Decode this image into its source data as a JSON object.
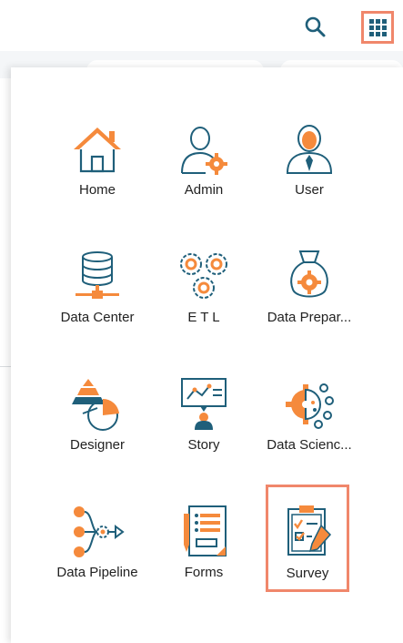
{
  "header": {
    "search_icon": "search-icon",
    "apps_icon": "apps-grid-icon"
  },
  "apps": [
    {
      "label": "Home",
      "icon": "home-icon"
    },
    {
      "label": "Admin",
      "icon": "admin-icon"
    },
    {
      "label": "User",
      "icon": "user-icon"
    },
    {
      "label": "Data Center",
      "icon": "data-center-icon"
    },
    {
      "label": "E T L",
      "icon": "etl-gears-icon"
    },
    {
      "label": "Data Prepar...",
      "icon": "data-preparation-icon"
    },
    {
      "label": "Designer",
      "icon": "designer-chart-icon"
    },
    {
      "label": "Story",
      "icon": "story-presentation-icon"
    },
    {
      "label": "Data Scienc...",
      "icon": "data-science-icon"
    },
    {
      "label": "Data Pipeline",
      "icon": "data-pipeline-icon"
    },
    {
      "label": "Forms",
      "icon": "forms-icon"
    },
    {
      "label": "Survey",
      "icon": "survey-clipboard-icon"
    }
  ],
  "colors": {
    "accent_orange": "#f58a3c",
    "highlight_border": "#f0876b",
    "icon_dark": "#1f5f7a"
  }
}
